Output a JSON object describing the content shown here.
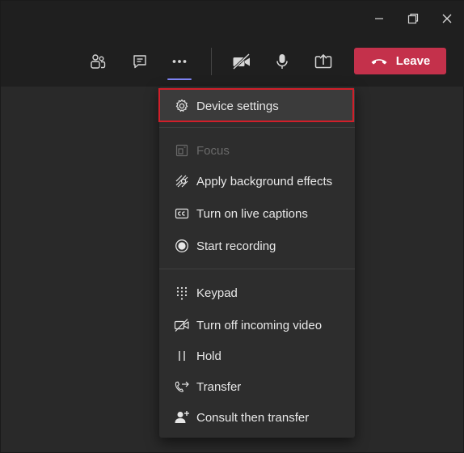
{
  "window": {
    "minimize_icon": "minimize-icon",
    "restore_icon": "restore-icon",
    "close_icon": "close-icon"
  },
  "toolbar": {
    "people_icon": "people-icon",
    "chat_icon": "chat-icon",
    "more_icon": "more-options-icon",
    "camera_icon": "camera-off-icon",
    "mic_icon": "microphone-icon",
    "share_icon": "share-screen-icon",
    "leave_label": "Leave",
    "leave_color": "#c4314b",
    "accent_color": "#7f85f5"
  },
  "menu": {
    "device_settings": "Device settings",
    "focus": "Focus",
    "background_effects": "Apply background effects",
    "live_captions": "Turn on live captions",
    "start_recording": "Start recording",
    "keypad": "Keypad",
    "turn_off_video": "Turn off incoming video",
    "hold": "Hold",
    "transfer": "Transfer",
    "consult_transfer": "Consult then transfer"
  }
}
